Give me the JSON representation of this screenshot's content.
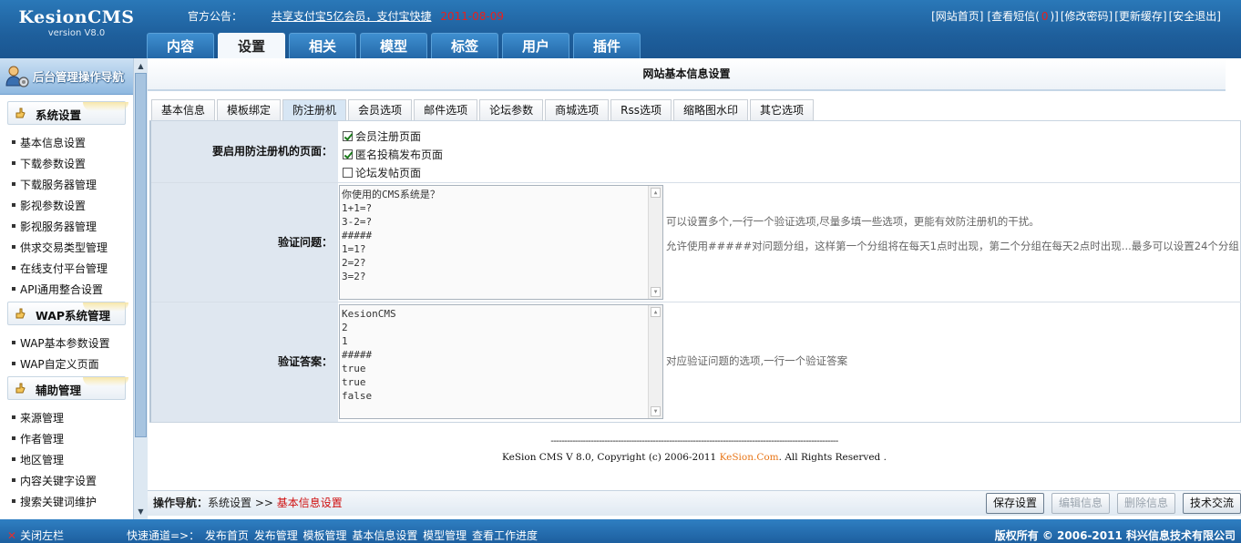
{
  "app": {
    "name": "KesionCMS",
    "version": "version V8.0"
  },
  "notice": {
    "label": "官方公告：",
    "link": "共享支付宝5亿会员，支付宝快捷",
    "date": "2011-08-09"
  },
  "top_links": {
    "home": "[网站首页]",
    "sms_pre": "[查看短信(",
    "sms_count": "0",
    "sms_post": ")]",
    "password": "[修改密码]",
    "cache": "[更新缓存]",
    "logout": "[安全退出]"
  },
  "main_tabs": [
    "内容",
    "设置",
    "相关",
    "模型",
    "标签",
    "用户",
    "插件"
  ],
  "active_main_tab": "设置",
  "sidebar": {
    "title": "后台管理操作导航",
    "sections": [
      {
        "title": "系统设置",
        "items": [
          "基本信息设置",
          "下载参数设置",
          "下载服务器管理",
          "影视参数设置",
          "影视服务器管理",
          "供求交易类型管理",
          "在线支付平台管理",
          "API通用整合设置"
        ]
      },
      {
        "title": "WAP系统管理",
        "items": [
          "WAP基本参数设置",
          "WAP自定义页面"
        ]
      },
      {
        "title": "辅助管理",
        "items": [
          "来源管理",
          "作者管理",
          "地区管理",
          "内容关键字设置",
          "搜索关键词维护"
        ]
      }
    ]
  },
  "page_title": "网站基本信息设置",
  "sub_tabs": [
    "基本信息",
    "模板绑定",
    "防注册机",
    "会员选项",
    "邮件选项",
    "论坛参数",
    "商城选项",
    "Rss选项",
    "缩略图水印",
    "其它选项"
  ],
  "active_sub_tab": "防注册机",
  "form": {
    "enable_label": "要启用防注册机的页面：",
    "checkboxes": [
      {
        "label": "会员注册页面",
        "checked": true
      },
      {
        "label": "匿名投稿发布页面",
        "checked": true
      },
      {
        "label": "论坛发帖页面",
        "checked": false
      }
    ],
    "question_label": "验证问题：",
    "question_value": "你使用的CMS系统是？\n1+1=?\n3-2=?\n#####\n1=1?\n2=2?\n3=2?",
    "question_desc_1": "可以设置多个,一行一个验证选项,尽量多填一些选项，更能有效防注册机的干扰。",
    "question_desc_2": "允许使用#####对问题分组，这样第一个分组将在每天1点时出现，第二个分组在每天2点时出现...最多可以设置24个分组",
    "answer_label": "验证答案：",
    "answer_value": "KesionCMS\n2\n1\n#####\ntrue\ntrue\nfalse",
    "answer_desc": "对应验证问题的选项,一行一个验证答案"
  },
  "copyright": {
    "dashes": "-----------------------------------------------------------------------------------------------------------",
    "pre": "KeSion CMS V 8.0, Copyright (c) 2006-2011 ",
    "brand": "KeSion.Com",
    "post": ". All Rights Reserved ."
  },
  "action_bar": {
    "crumb_label": "操作导航：",
    "crumb_section": "系统设置",
    "crumb_sep": ">>",
    "crumb_current": "基本信息设置",
    "save": "保存设置",
    "edit": "编辑信息",
    "delete": "删除信息",
    "support": "技术交流"
  },
  "footer": {
    "close": "关闭左栏",
    "quick": "快速通道=>： 发布首页 发布管理 模板管理 基本信息设置 模型管理 查看工作进度",
    "copyright": "版权所有 © 2006-2011 科兴信息技术有限公司"
  }
}
